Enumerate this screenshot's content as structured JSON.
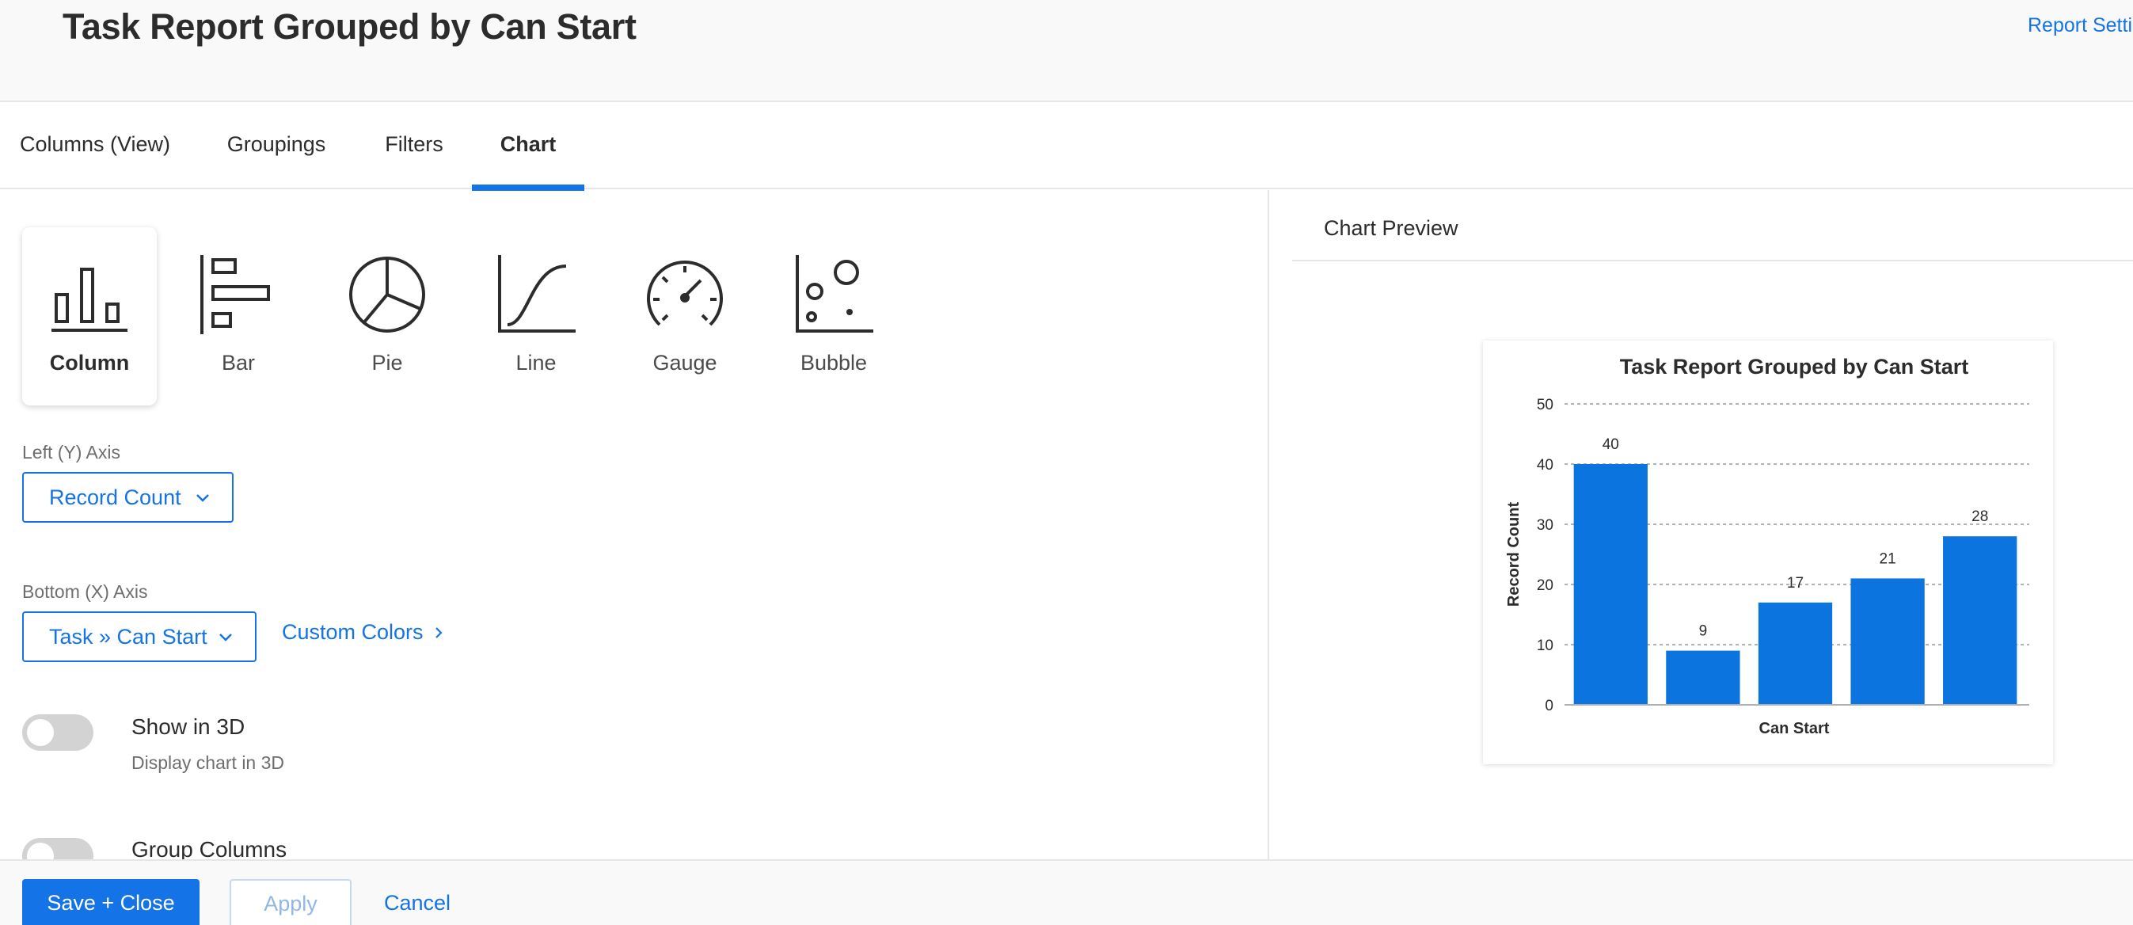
{
  "header": {
    "title": "Task Report Grouped by Can Start",
    "report_settings": "Report Settir"
  },
  "tabs": [
    {
      "label": "Columns (View)",
      "active": false
    },
    {
      "label": "Groupings",
      "active": false
    },
    {
      "label": "Filters",
      "active": false
    },
    {
      "label": "Chart",
      "active": true
    }
  ],
  "chart_types": [
    {
      "label": "Column",
      "icon": "column-chart-icon",
      "selected": true
    },
    {
      "label": "Bar",
      "icon": "bar-chart-icon",
      "selected": false
    },
    {
      "label": "Pie",
      "icon": "pie-chart-icon",
      "selected": false
    },
    {
      "label": "Line",
      "icon": "line-chart-icon",
      "selected": false
    },
    {
      "label": "Gauge",
      "icon": "gauge-chart-icon",
      "selected": false
    },
    {
      "label": "Bubble",
      "icon": "bubble-chart-icon",
      "selected": false
    }
  ],
  "left_axis": {
    "label": "Left (Y) Axis",
    "value": "Record Count"
  },
  "bottom_axis": {
    "label": "Bottom (X) Axis",
    "value": "Task » Can Start"
  },
  "custom_colors": "Custom Colors",
  "toggles": {
    "show_3d": {
      "title": "Show in 3D",
      "desc": "Display chart in 3D",
      "on": false
    },
    "group_columns": {
      "title": "Group Columns",
      "on": false
    }
  },
  "preview": {
    "title": "Chart Preview"
  },
  "chart_data": {
    "type": "bar",
    "title": "Task Report Grouped by Can Start",
    "xlabel": "Can Start",
    "ylabel": "Record Count",
    "categories": [
      "",
      "",
      "",
      "",
      ""
    ],
    "values": [
      40,
      9,
      17,
      21,
      28
    ],
    "ylim": [
      0,
      50
    ],
    "yticks": [
      0,
      10,
      20,
      30,
      40,
      50
    ],
    "grid": true,
    "bar_color": "#0b74de"
  },
  "footer": {
    "save_close": "Save + Close",
    "apply": "Apply",
    "cancel": "Cancel"
  },
  "colors": {
    "accent": "#1473e6"
  }
}
